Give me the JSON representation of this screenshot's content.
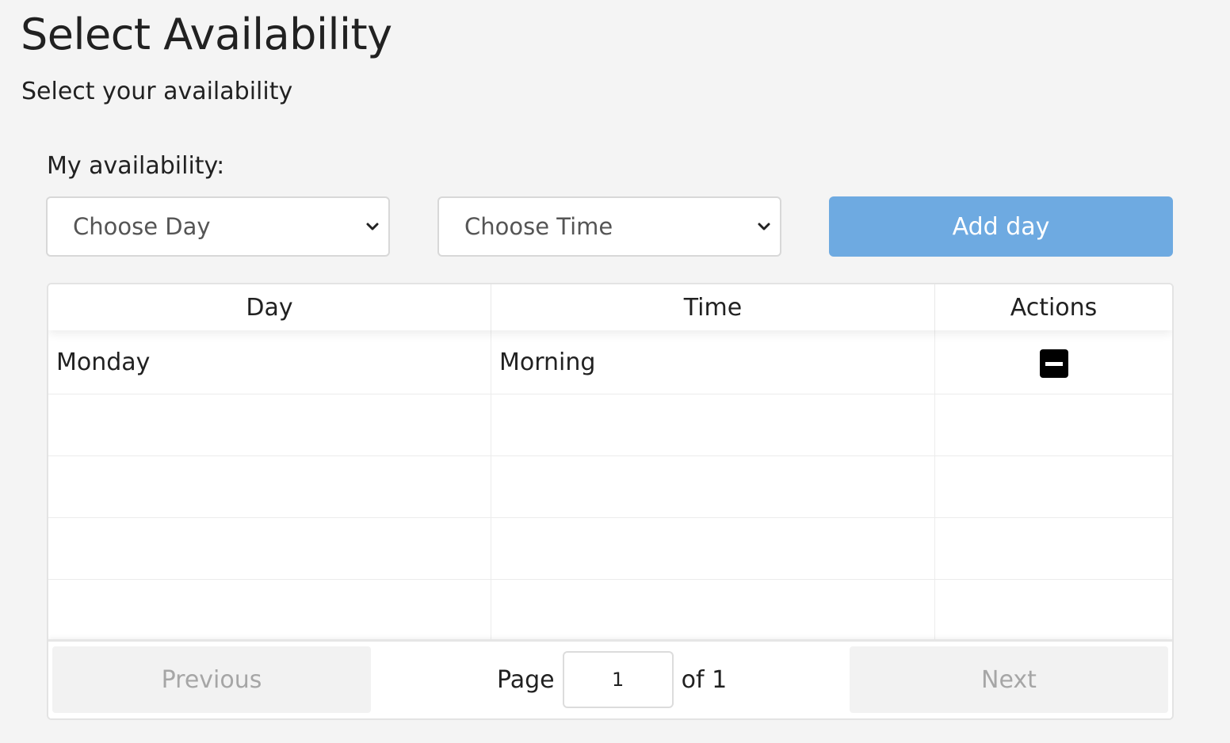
{
  "header": {
    "title": "Select Availability",
    "subtitle": "Select your availability"
  },
  "form": {
    "label": "My availability:",
    "day_select": {
      "selected": "Choose Day"
    },
    "time_select": {
      "selected": "Choose Time"
    },
    "add_button": "Add day"
  },
  "table": {
    "columns": [
      "Day",
      "Time",
      "Actions"
    ],
    "rows": [
      {
        "day": "Monday",
        "time": "Morning",
        "action_icon": "minus-square-icon"
      }
    ]
  },
  "pagination": {
    "previous": "Previous",
    "page_label": "Page",
    "current_page": "1",
    "of_label": "of 1",
    "next": "Next"
  },
  "colors": {
    "accent": "#6eaae1",
    "background": "#f4f4f4"
  }
}
